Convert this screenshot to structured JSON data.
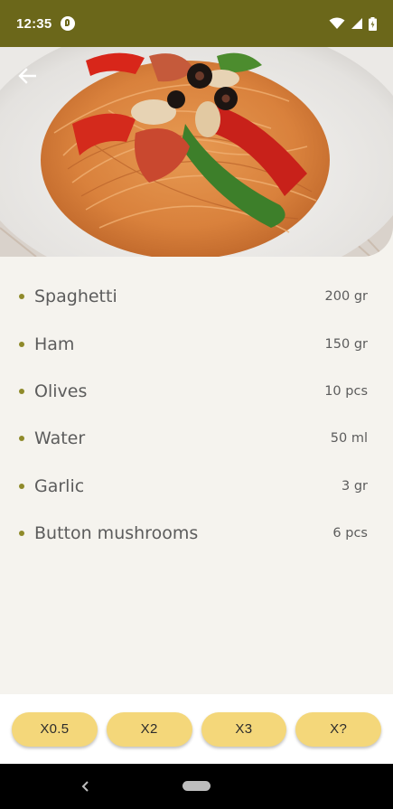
{
  "status_bar": {
    "time": "12:35",
    "icons": [
      "app-notification-icon",
      "wifi-icon",
      "cellular-signal-icon",
      "battery-icon"
    ]
  },
  "hero": {
    "image": "spaghetti-dish-image",
    "back_icon": "arrow-left-icon"
  },
  "ingredients": [
    {
      "name": "Spaghetti",
      "qty": "200 gr"
    },
    {
      "name": "Ham",
      "qty": "150 gr"
    },
    {
      "name": "Olives",
      "qty": "10 pcs"
    },
    {
      "name": "Water",
      "qty": "50 ml"
    },
    {
      "name": "Garlic",
      "qty": "3 gr"
    },
    {
      "name": "Button mushrooms",
      "qty": "6 pcs"
    }
  ],
  "multipliers": [
    "X0.5",
    "X2",
    "X3",
    "X?"
  ],
  "colors": {
    "status_bar": "#6b671a",
    "accent_bullet": "#8f8a2a",
    "button": "#f4d77a",
    "background": "#f5f3ee"
  },
  "nav": {
    "back_icon": "nav-back-icon",
    "home_icon": "home-pill-icon"
  }
}
